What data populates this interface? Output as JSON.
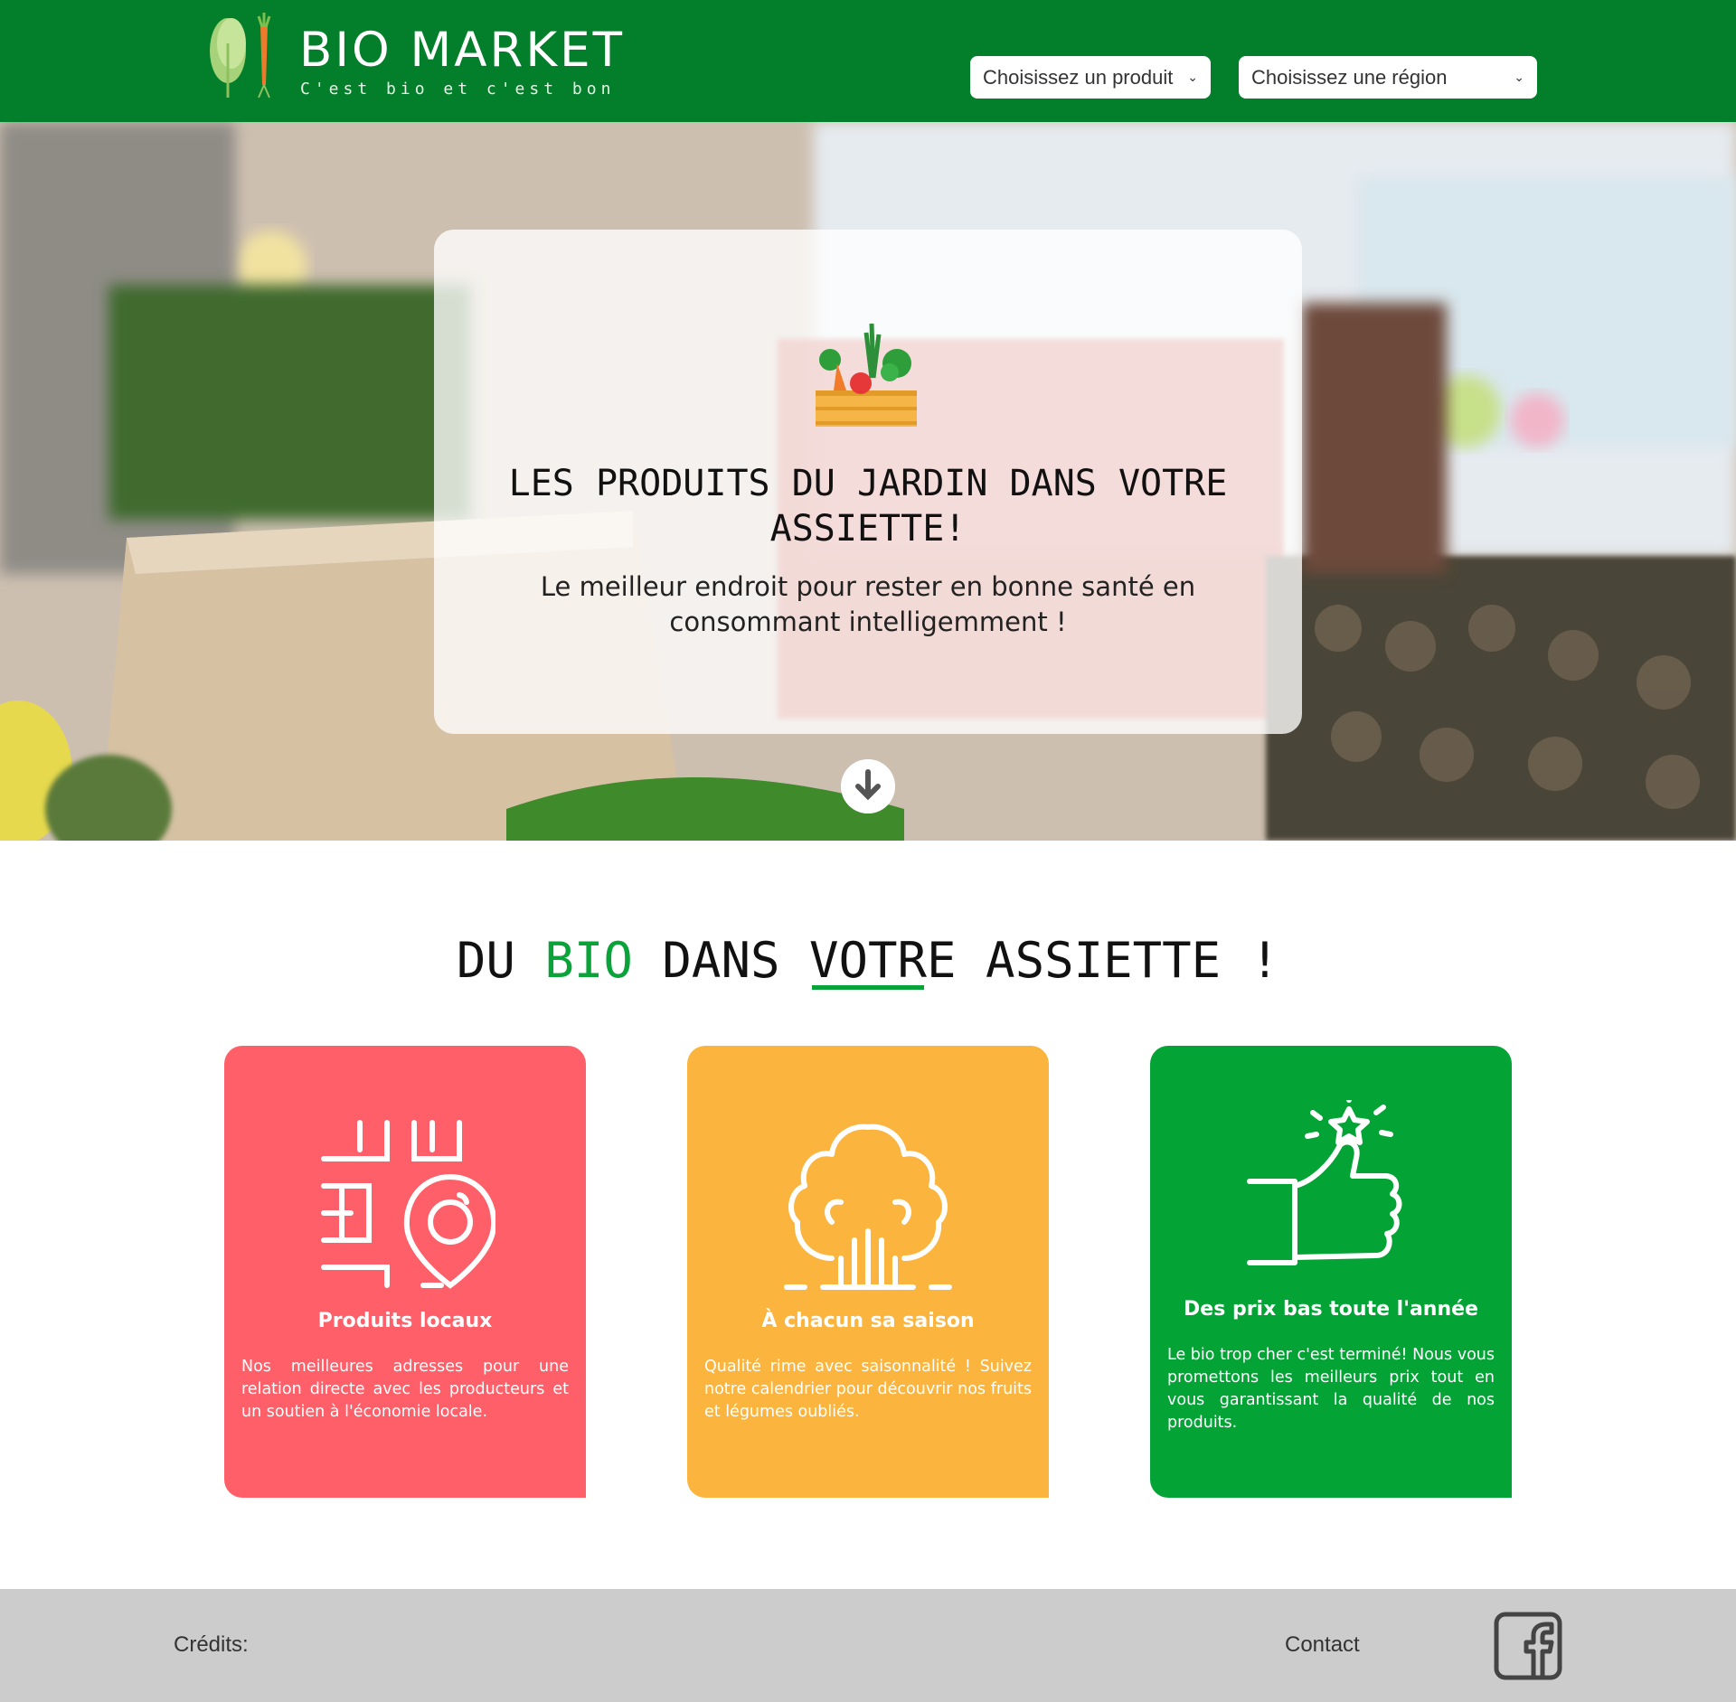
{
  "header": {
    "brand_name": "BIO MARKET",
    "tagline": "C'est bio et c'est bon",
    "product_select": {
      "selected": "Choisissez un produit"
    },
    "region_select": {
      "selected": "Choisissez une région"
    }
  },
  "hero": {
    "title": "LES PRODUITS DU JARDIN DANS VOTRE ASSIETTE!",
    "subtitle": "Le meilleur endroit pour rester en bonne santé en consommant intelligemment !",
    "down_icon": "arrow-down-circle-icon"
  },
  "section": {
    "title_part1": "DU ",
    "title_accent": "BIO",
    "title_part2": " DANS ",
    "title_underlined": "VOTRE",
    "title_part3": " ASSIETTE !"
  },
  "cards": [
    {
      "icon": "map-location-icon",
      "title": "Produits locaux",
      "text": "Nos meilleures adresses pour une relation directe avec les producteurs et un soutien à l'économie locale.",
      "color": "#fe5f69"
    },
    {
      "icon": "tree-icon",
      "title": "À chacun sa saison",
      "text": "Qualité rime avec saisonnalité ! Suivez notre calendrier pour découvrir nos fruits et légumes oubliés.",
      "color": "#fbb53f"
    },
    {
      "icon": "thumbs-up-star-icon",
      "title": "Des prix bas toute l'année",
      "text": "Le bio trop cher c'est terminé! Nous vous promettons les meilleurs prix tout en vous garantissant la qualité de nos produits.",
      "color": "#03a335"
    }
  ],
  "footer": {
    "credits": "Crédits:",
    "contact": "Contact",
    "social_icon": "facebook-icon"
  },
  "colors": {
    "header_green": "#037e2a",
    "accent_green": "#0aa33a",
    "footer_gray": "#cccccc"
  }
}
